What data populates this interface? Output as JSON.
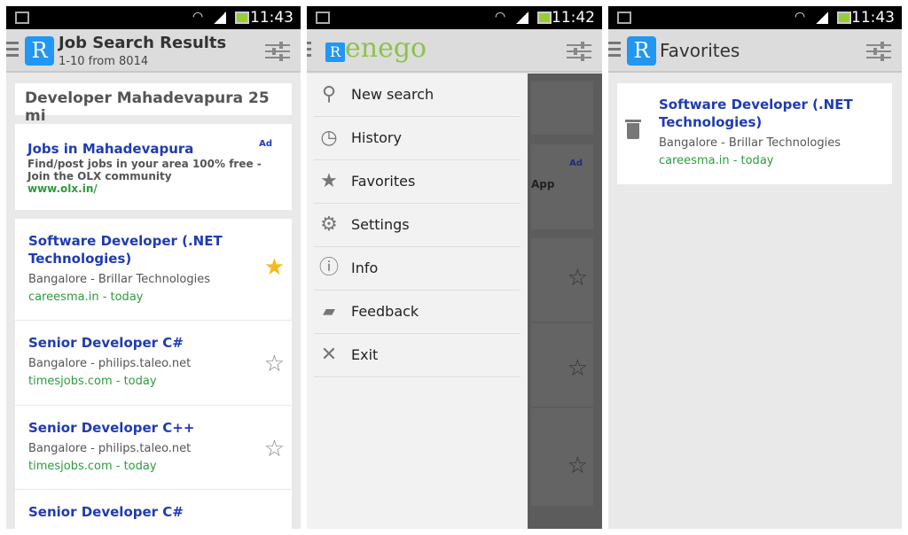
{
  "screens": [
    {
      "status_time": "11:43",
      "title": "Job Search Results",
      "subtitle": "1-10 from 8014",
      "search_query": "Developer Mahadevapura 25 mi",
      "ad": {
        "title": "Jobs in Mahadevapura",
        "badge": "Ad",
        "text": "Find/post jobs in your area 100% free - Join the OLX community",
        "url": "www.olx.in/"
      },
      "jobs": [
        {
          "title": "Software Developer (.NET Technologies)",
          "location": "Bangalore - Brillar Technologies",
          "source": "careesma.in - today",
          "favorite": true
        },
        {
          "title": "Senior Developer C#",
          "location": "Bangalore - philips.taleo.net",
          "source": "timesjobs.com - today",
          "favorite": false
        },
        {
          "title": "Senior Developer C++",
          "location": "Bangalore - philips.taleo.net",
          "source": "timesjobs.com - today",
          "favorite": false
        },
        {
          "title": "Senior Developer C#",
          "location": "",
          "source": "",
          "favorite": false
        }
      ]
    },
    {
      "status_time": "11:42",
      "brand": "enego",
      "overlay_ad_badge": "Ad",
      "overlay_text": "App",
      "menu": [
        {
          "label": "New search",
          "icon": "search-icon"
        },
        {
          "label": "History",
          "icon": "clock-icon"
        },
        {
          "label": "Favorites",
          "icon": "star-icon"
        },
        {
          "label": "Settings",
          "icon": "gear-icon"
        },
        {
          "label": "Info",
          "icon": "info-icon"
        },
        {
          "label": "Feedback",
          "icon": "chat-icon"
        },
        {
          "label": "Exit",
          "icon": "close-icon"
        }
      ]
    },
    {
      "status_time": "11:43",
      "title": "Favorites",
      "favorites": [
        {
          "title": "Software Developer (.NET Technologies)",
          "location": "Bangalore - Brillar Technologies",
          "source": "careesma.in - today"
        }
      ]
    }
  ],
  "colors": {
    "accent": "#2196f3",
    "link": "#1f3bb3",
    "source": "#2e9b3e",
    "star_active": "#f6b81c",
    "brand_green": "#8bc34a"
  }
}
